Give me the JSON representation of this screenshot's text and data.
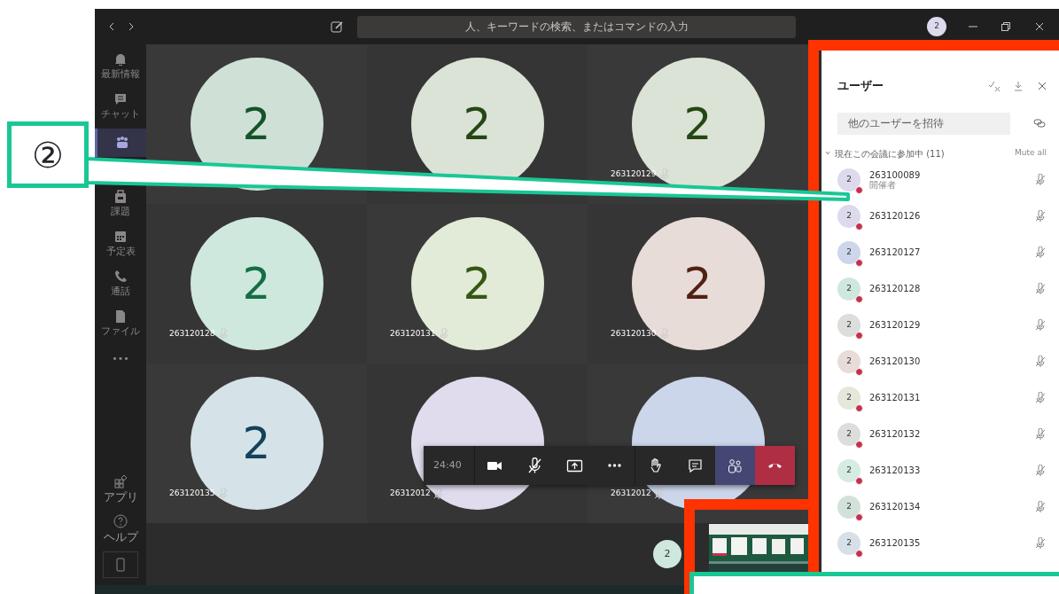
{
  "callout": {
    "text": "②"
  },
  "title_bar": {
    "search": {
      "placeholder": "人、キーワードの検索、またはコマンドの入力"
    },
    "avatar": "2"
  },
  "app_bar": {
    "items": [
      {
        "kind": "bell",
        "label": "最新情報",
        "selected": false
      },
      {
        "kind": "chat",
        "label": "チャット",
        "selected": false
      },
      {
        "kind": "teams",
        "selected": true
      },
      {
        "kind": "bag",
        "label": "課題",
        "selected": false
      },
      {
        "kind": "calendar",
        "label": "予定表",
        "selected": false
      },
      {
        "kind": "phone",
        "label": "通話",
        "selected": false
      },
      {
        "kind": "file",
        "label": "ファイル",
        "selected": false
      },
      {
        "kind": "more",
        "label": "•••",
        "selected": false
      }
    ],
    "bottom_items": [
      {
        "kind": "apps",
        "label": "アプリ",
        "selected": false
      },
      {
        "kind": "help",
        "label": "ヘルプ",
        "selected": false
      },
      {
        "kind": "device",
        "selected": false
      }
    ]
  },
  "tiles": [
    {
      "initial": "2",
      "color": "#cfe0d6"
    },
    {
      "initial": "2",
      "color": "#dbe3d6"
    },
    {
      "initial": "2",
      "name": "263120129",
      "color": "#dbe3d6",
      "muted": true
    },
    {
      "initial": "2",
      "name": "263120128",
      "color": "#cfe8de",
      "muted": true
    },
    {
      "initial": "2",
      "name": "263120131",
      "color": "#e2ead8",
      "muted": true
    },
    {
      "initial": "2",
      "name": "263120130",
      "color": "#e8dcd8",
      "muted": true
    },
    {
      "initial": "2",
      "name": "263120135",
      "color": "#d5e3e8",
      "muted": true
    },
    {
      "name": "26312012",
      "color": "#e0dcee",
      "muted": true
    },
    {
      "name": "26312012",
      "color": "#cbd6ea",
      "muted": true
    }
  ],
  "call_controls": {
    "timer": "24:40",
    "buttons": [
      {
        "kind": "video",
        "selected": false
      },
      {
        "kind": "mic_off",
        "selected": false
      },
      {
        "kind": "share",
        "selected": false
      },
      {
        "kind": "more",
        "selected": false
      },
      {
        "kind": "hand",
        "selected": false
      },
      {
        "kind": "chat",
        "selected": false
      },
      {
        "kind": "people",
        "selected": true
      },
      {
        "kind": "hangup",
        "selected": false
      }
    ]
  },
  "self_avatar": "2",
  "people_panel": {
    "title": "ユーザー",
    "invite": {
      "placeholder": "他のユーザーを招待"
    },
    "section": "現在この会議に参加中 (11)",
    "mute_all": "Mute all",
    "participants": [
      {
        "initial": "2",
        "name": "263100089",
        "role": "開催者",
        "color": "#dcdaec",
        "muted": true
      },
      {
        "initial": "2",
        "name": "263120126",
        "color": "#dcdaec",
        "muted": true
      },
      {
        "initial": "2",
        "name": "263120127",
        "color": "#cdd6ea",
        "muted": true
      },
      {
        "initial": "2",
        "name": "263120128",
        "color": "#cfe8de",
        "muted": true
      },
      {
        "initial": "2",
        "name": "263120129",
        "color": "#dcdedb",
        "muted": true
      },
      {
        "initial": "2",
        "name": "263120130",
        "color": "#e8dcd8",
        "muted": true
      },
      {
        "initial": "2",
        "name": "263120131",
        "color": "#e4e8da",
        "muted": true
      },
      {
        "initial": "2",
        "name": "263120132",
        "color": "#dcdedb",
        "muted": true
      },
      {
        "initial": "2",
        "name": "263120133",
        "color": "#d6ebe2",
        "muted": true
      },
      {
        "initial": "2",
        "name": "263120134",
        "color": "#d2e2da",
        "muted": true
      },
      {
        "initial": "2",
        "name": "263120135",
        "color": "#d5e0e8",
        "muted": true
      }
    ]
  }
}
